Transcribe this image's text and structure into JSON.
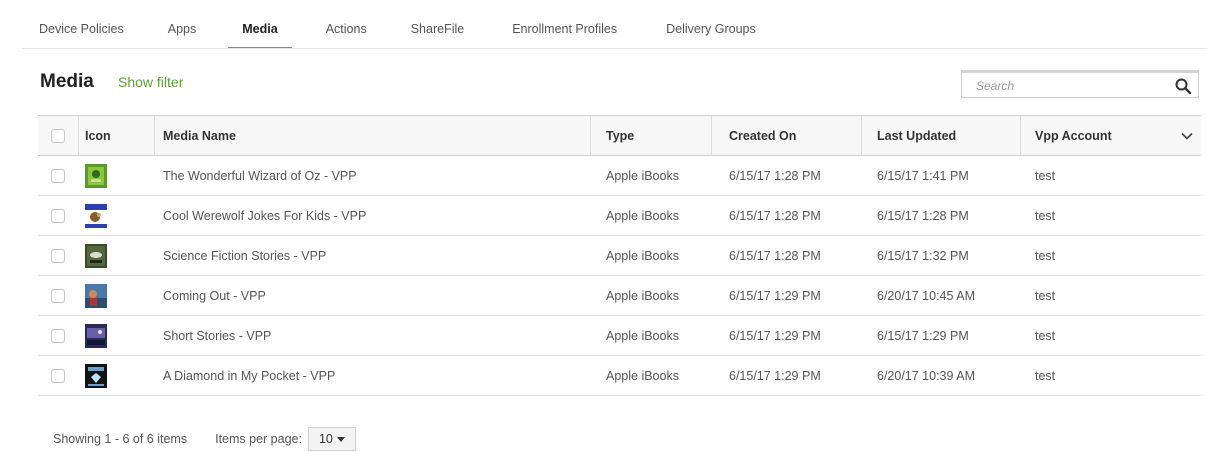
{
  "tabs": [
    {
      "label": "Device Policies",
      "active": false
    },
    {
      "label": "Apps",
      "active": false
    },
    {
      "label": "Media",
      "active": true
    },
    {
      "label": "Actions",
      "active": false
    },
    {
      "label": "ShareFile",
      "active": false
    },
    {
      "label": "Enrollment Profiles",
      "active": false
    },
    {
      "label": "Delivery Groups",
      "active": false
    }
  ],
  "header": {
    "title": "Media",
    "show_filter": "Show filter"
  },
  "search": {
    "placeholder": "Search",
    "value": "",
    "icon": "search-icon"
  },
  "table": {
    "columns": {
      "icon": "Icon",
      "media_name": "Media Name",
      "type": "Type",
      "created_on": "Created On",
      "last_updated": "Last Updated",
      "vpp_account": "Vpp Account"
    },
    "rows": [
      {
        "icon": "wizard-of-oz-cover",
        "name": "The Wonderful Wizard of Oz - VPP",
        "type": "Apple iBooks",
        "created": "6/15/17 1:28 PM",
        "updated": "6/15/17 1:41 PM",
        "vpp": "test"
      },
      {
        "icon": "werewolf-jokes-cover",
        "name": "Cool Werewolf Jokes For Kids - VPP",
        "type": "Apple iBooks",
        "created": "6/15/17 1:28 PM",
        "updated": "6/15/17 1:28 PM",
        "vpp": "test"
      },
      {
        "icon": "science-fiction-cover",
        "name": "Science Fiction Stories - VPP",
        "type": "Apple iBooks",
        "created": "6/15/17 1:28 PM",
        "updated": "6/15/17 1:32 PM",
        "vpp": "test"
      },
      {
        "icon": "coming-out-cover",
        "name": "Coming Out - VPP",
        "type": "Apple iBooks",
        "created": "6/15/17 1:29 PM",
        "updated": "6/20/17 10:45 AM",
        "vpp": "test"
      },
      {
        "icon": "short-stories-cover",
        "name": "Short Stories - VPP",
        "type": "Apple iBooks",
        "created": "6/15/17 1:29 PM",
        "updated": "6/15/17 1:29 PM",
        "vpp": "test"
      },
      {
        "icon": "diamond-pocket-cover",
        "name": "A Diamond in My Pocket - VPP",
        "type": "Apple iBooks",
        "created": "6/15/17 1:29 PM",
        "updated": "6/20/17 10:39 AM",
        "vpp": "test"
      }
    ]
  },
  "footer": {
    "showing": "Showing 1 - 6 of 6 items",
    "items_per_page_label": "Items per page:",
    "items_per_page_value": "10"
  },
  "colors": {
    "accent_green": "#5f9e3a",
    "active_tab_underline": "#8a8a8a",
    "header_bg": "#f7f7f7"
  }
}
